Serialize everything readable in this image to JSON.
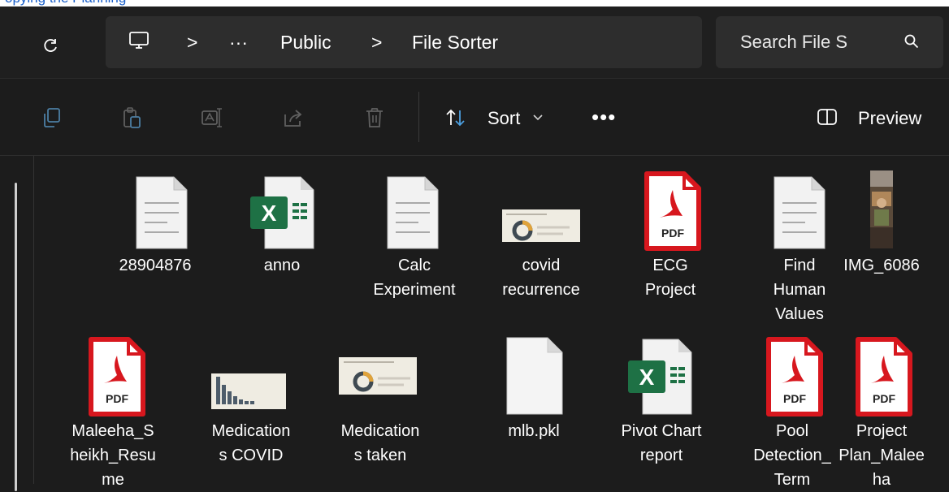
{
  "top_banner": {
    "text": "opying the Planning"
  },
  "address_bar": {
    "breadcrumb_more": "···",
    "breadcrumb_public": "Public",
    "breadcrumb_current": "File Sorter",
    "separator": ">",
    "search_placeholder": "Search File S"
  },
  "toolbar": {
    "sort_label": "Sort",
    "more_label": "•••",
    "preview_label": "Preview"
  },
  "icons": {
    "text_file": "document-icon",
    "excel_file": "excel-icon",
    "pdf_file": "pdf-icon",
    "image_file": "image-thumbnail",
    "blank_file": "blank-file-icon"
  },
  "colors": {
    "background": "#1c1c1c",
    "pdf_red": "#d7171e",
    "excel_green": "#1e7145",
    "banner_text": "#1a5fc9"
  },
  "files": [
    {
      "label": "28904876",
      "type": "text"
    },
    {
      "label": "anno",
      "type": "excel"
    },
    {
      "label": "Calc\nExperiment",
      "type": "text"
    },
    {
      "label": "covid\nrecurrence",
      "type": "image"
    },
    {
      "label": "ECG\nProject",
      "type": "pdf"
    },
    {
      "label": "Find\nHuman\nValues",
      "type": "text"
    },
    {
      "label": "IMG_6086",
      "type": "photo"
    },
    {
      "label": "Maleeha_S\nheikh_Resu\nme",
      "type": "pdf"
    },
    {
      "label": "Medication\ns COVID",
      "type": "image"
    },
    {
      "label": "Medication\ns taken",
      "type": "image"
    },
    {
      "label": "mlb.pkl",
      "type": "blank"
    },
    {
      "label": "Pivot Chart\nreport",
      "type": "excel"
    },
    {
      "label": "Pool\nDetection_\nTerm",
      "type": "pdf"
    },
    {
      "label": "Project\nPlan_Malee\nha",
      "type": "pdf"
    }
  ],
  "pdf_badge": "PDF",
  "excel_letter": "X"
}
